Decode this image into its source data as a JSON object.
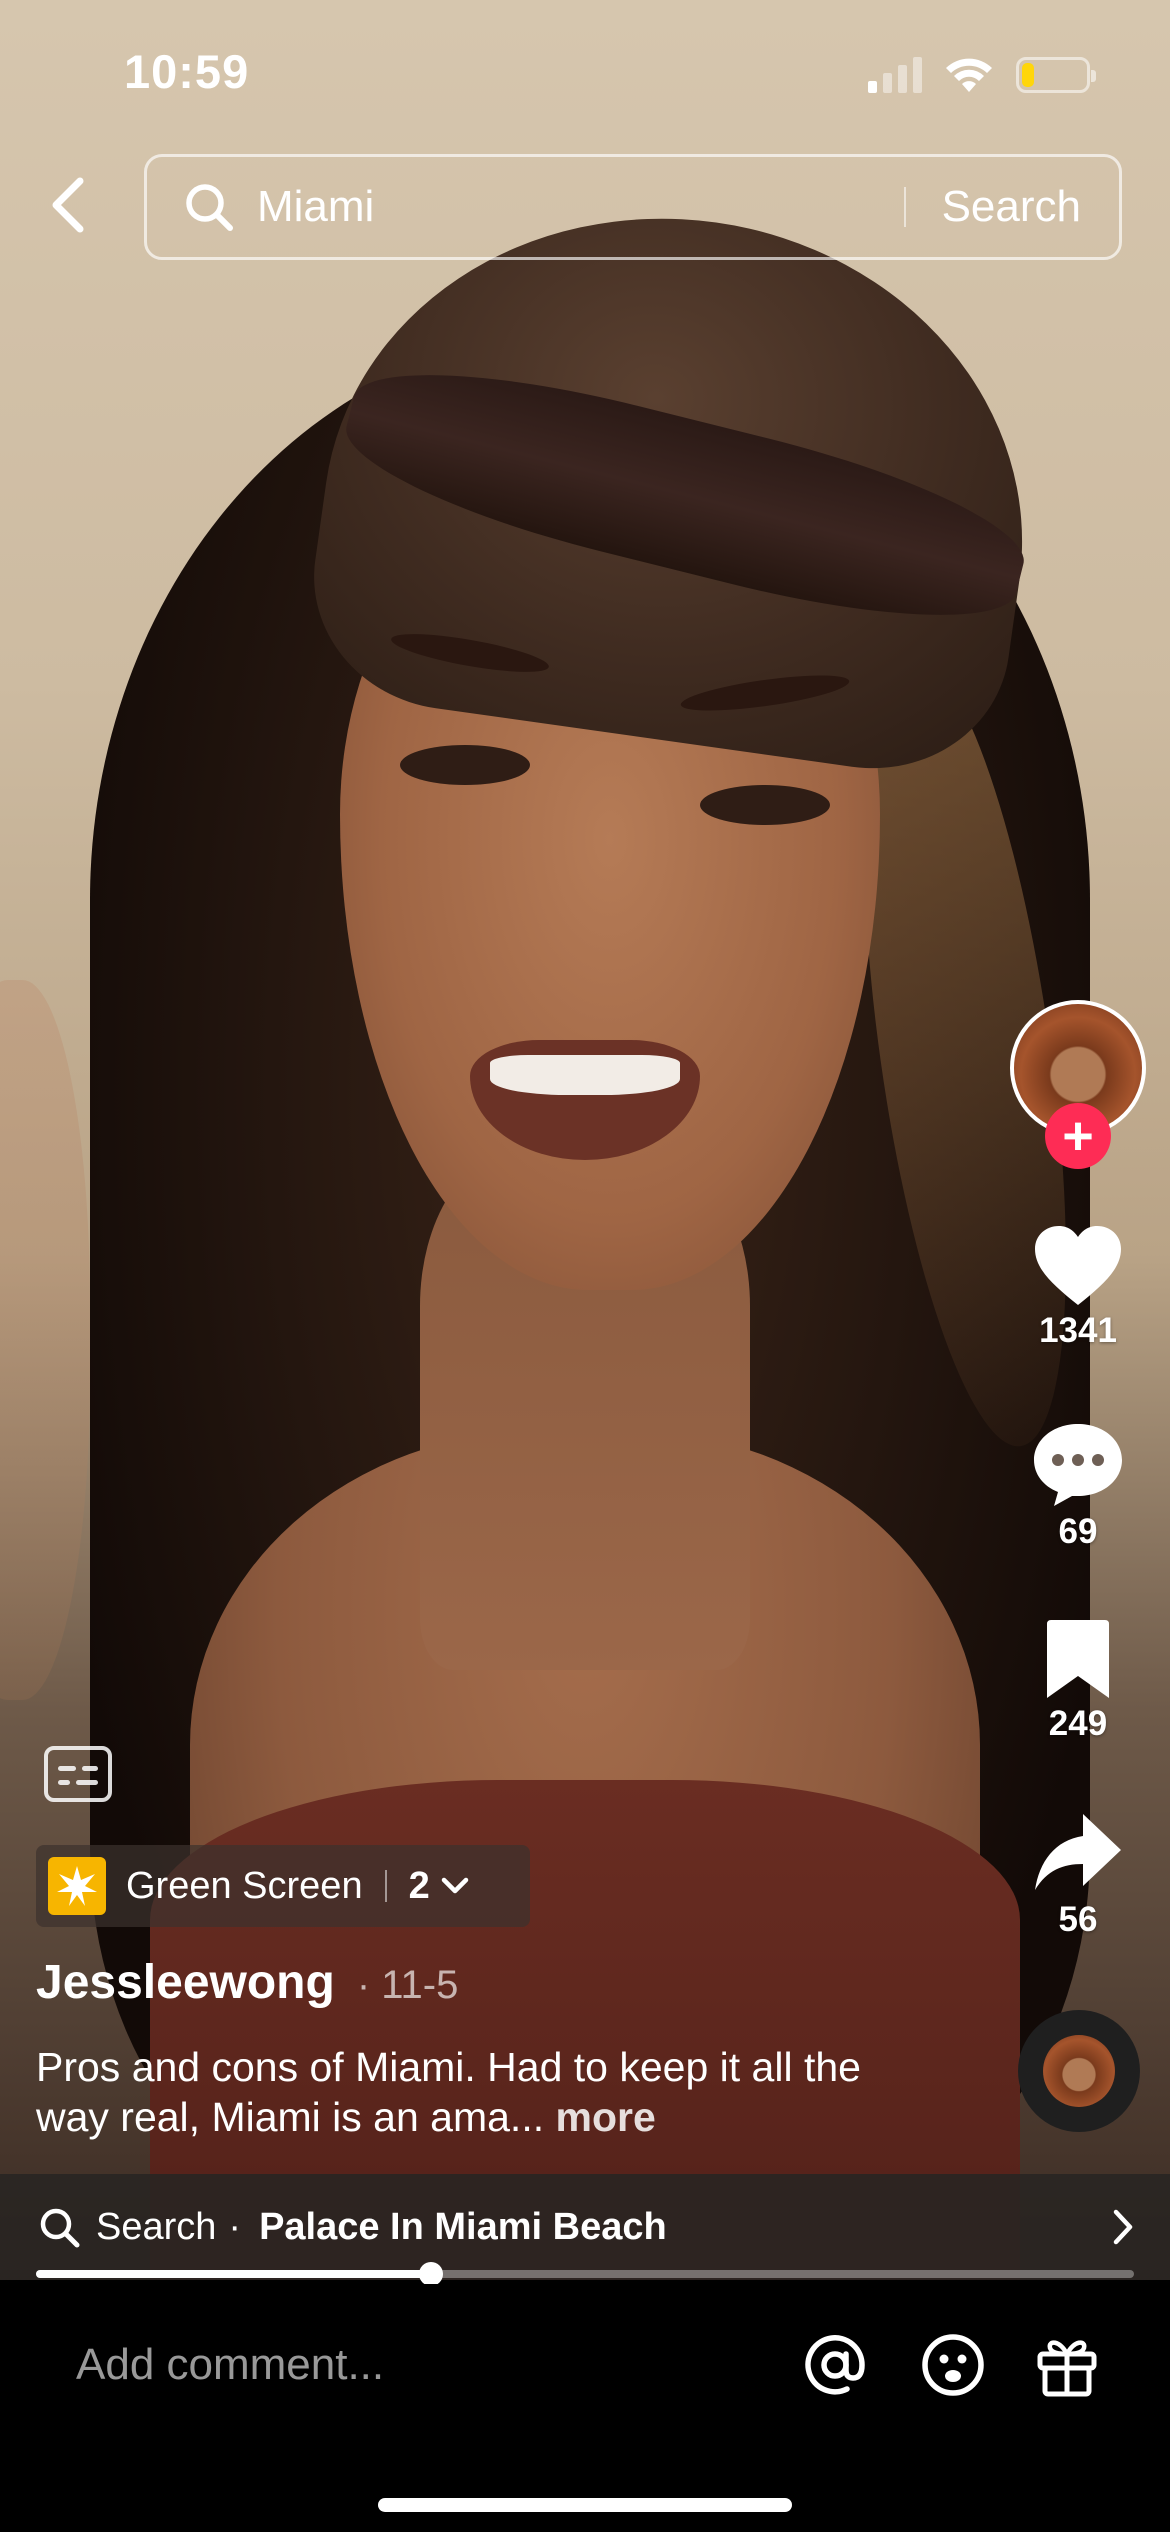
{
  "status_bar": {
    "time": "10:59",
    "battery_level": 0.2
  },
  "header": {
    "back_icon": "chevron-left-icon",
    "search_query": "Miami",
    "search_button": "Search"
  },
  "rail": {
    "likes": "1341",
    "comments": "69",
    "saves": "249",
    "shares": "56",
    "follow_symbol": "+"
  },
  "effect": {
    "label": "Green Screen",
    "count": "2"
  },
  "post": {
    "author": "Jessleewong",
    "date": "· 11-5",
    "caption": "Pros and cons of Miami. Had to keep it all the way real, Miami is an ama...",
    "more": " more"
  },
  "suggestion": {
    "label": "Search",
    "dot": "·",
    "term": "Palace In Miami Beach"
  },
  "playback": {
    "progress": 0.36
  },
  "comment_bar": {
    "placeholder": "Add comment..."
  },
  "colors": {
    "accent": "#fe2c55",
    "battery": "#ffd60a",
    "effect_icon": "#f7b500"
  }
}
